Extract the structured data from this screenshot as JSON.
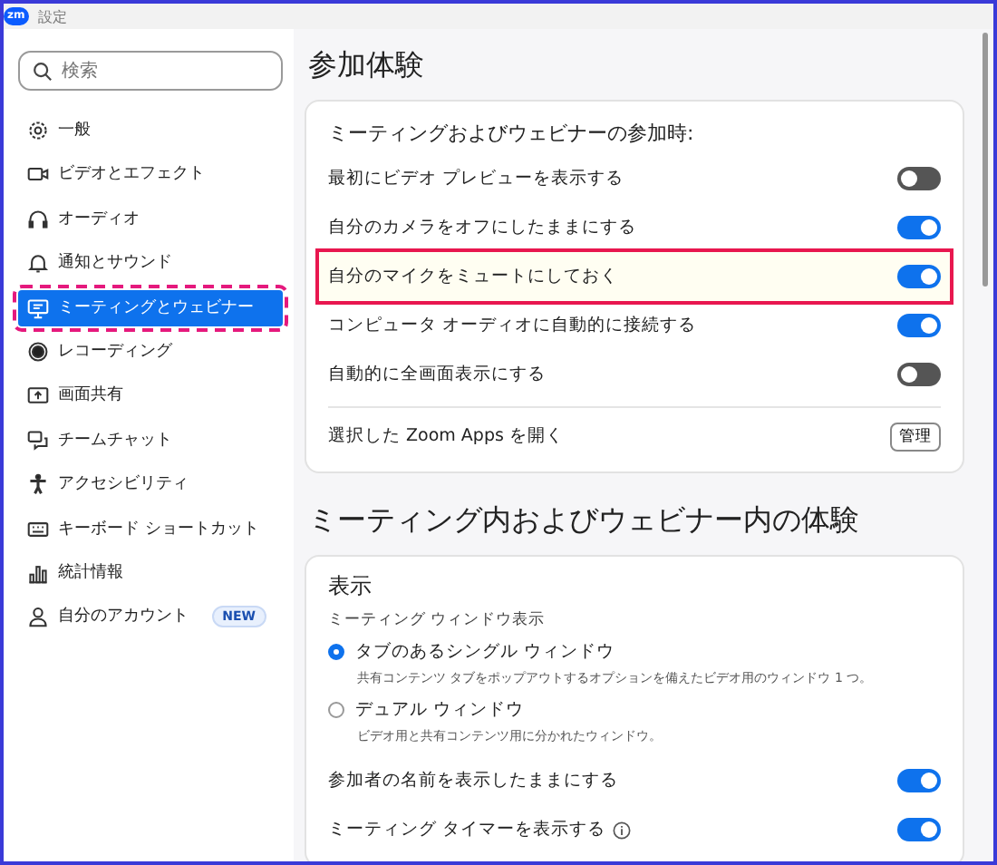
{
  "window": {
    "logo": "zm",
    "title": "設定"
  },
  "search": {
    "placeholder": "検索"
  },
  "sidebar": {
    "items": [
      {
        "label": "一般",
        "selected": false
      },
      {
        "label": "ビデオとエフェクト",
        "selected": false
      },
      {
        "label": "オーディオ",
        "selected": false
      },
      {
        "label": "通知とサウンド",
        "selected": false
      },
      {
        "label": "ミーティングとウェビナー",
        "selected": true
      },
      {
        "label": "レコーディング",
        "selected": false
      },
      {
        "label": "画面共有",
        "selected": false
      },
      {
        "label": "チームチャット",
        "selected": false
      },
      {
        "label": "アクセシビリティ",
        "selected": false
      },
      {
        "label": "キーボード ショートカット",
        "selected": false
      },
      {
        "label": "統計情報",
        "selected": false
      },
      {
        "label": "自分のアカウント",
        "selected": false,
        "badge": "NEW"
      }
    ]
  },
  "join_section": {
    "heading": "参加体験",
    "card_title": "ミーティングおよびウェビナーの参加時:",
    "rows": [
      {
        "label": "最初にビデオ プレビューを表示する",
        "on": false,
        "highlighted": false
      },
      {
        "label": "自分のカメラをオフにしたままにする",
        "on": true,
        "highlighted": false
      },
      {
        "label": "自分のマイクをミュートにしておく",
        "on": true,
        "highlighted": true
      },
      {
        "label": "コンピュータ オーディオに自動的に接続する",
        "on": true,
        "highlighted": false
      },
      {
        "label": "自動的に全画面表示にする",
        "on": false,
        "highlighted": false
      }
    ],
    "apps_row": {
      "label": "選択した Zoom Apps を開く",
      "button": "管理"
    }
  },
  "in_meeting_section": {
    "heading": "ミーティング内およびウェビナー内の体験",
    "card_title": "表示",
    "subtitle": "ミーティング ウィンドウ表示",
    "radios": [
      {
        "label": "タブのあるシングル ウィンドウ",
        "description": "共有コンテンツ タブをポップアウトするオプションを備えたビデオ用のウィンドウ 1 つ。",
        "selected": true
      },
      {
        "label": "デュアル ウィンドウ",
        "description": "ビデオ用と共有コンテンツ用に分かれたウィンドウ。",
        "selected": false
      }
    ],
    "rows": [
      {
        "label": "参加者の名前を表示したままにする",
        "on": true,
        "info": false
      },
      {
        "label": "ミーティング タイマーを表示する",
        "on": true,
        "info": true
      }
    ]
  }
}
